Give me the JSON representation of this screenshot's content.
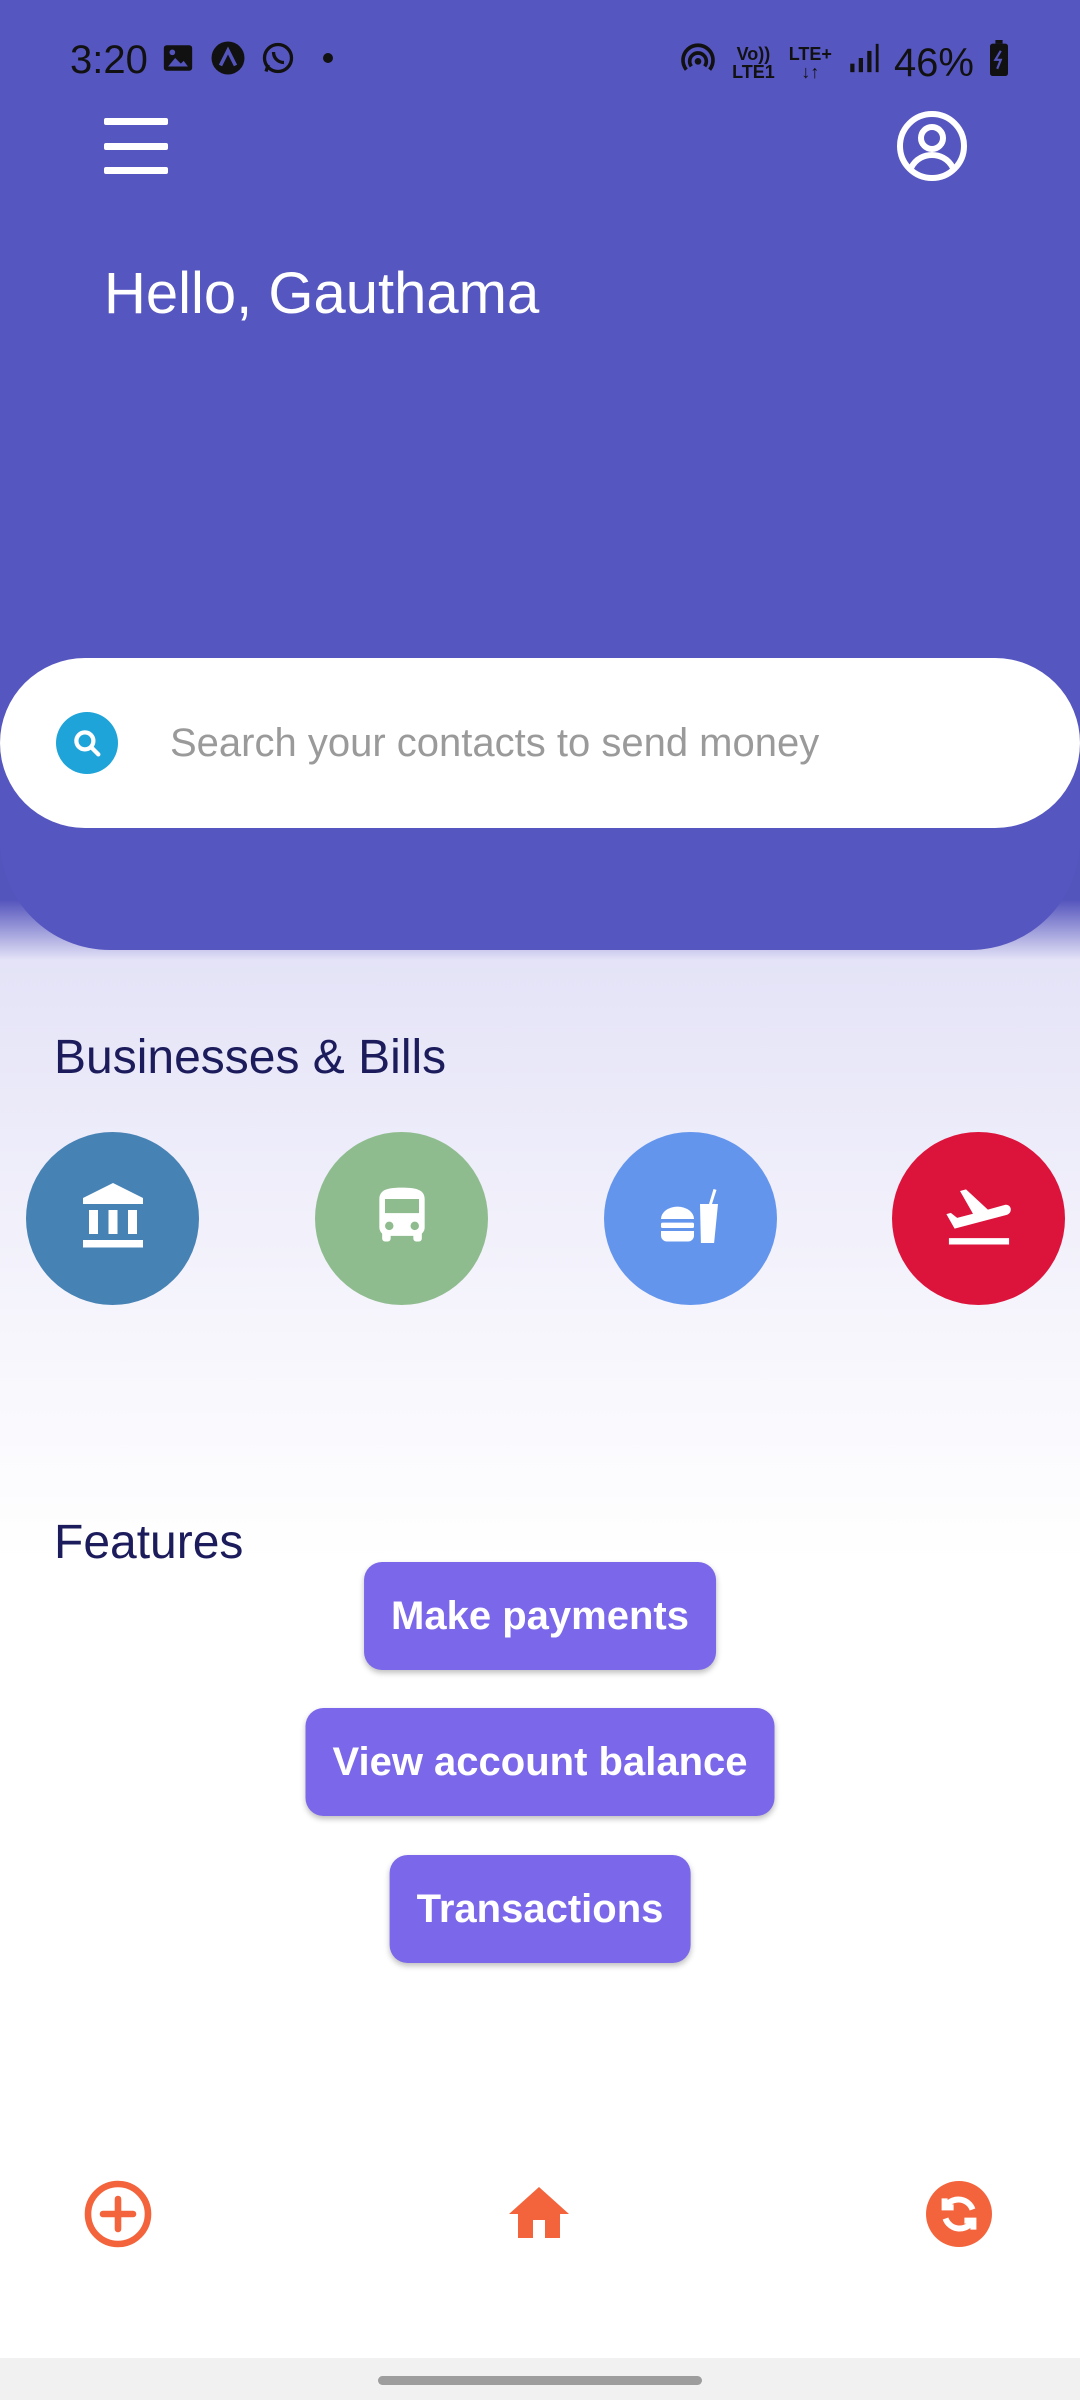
{
  "status_bar": {
    "time": "3:20",
    "left_icons": [
      "image-icon",
      "app-a-icon",
      "whatsapp-icon",
      "dot-icon"
    ],
    "network_labels": {
      "volte_top": "Vo))",
      "volte_bottom": "LTE1",
      "lte_top": "LTE+",
      "lte_bottom": "↓↑"
    },
    "battery": "46%"
  },
  "header": {
    "greeting": "Hello, Gauthama",
    "menu_icon": "hamburger-menu-icon",
    "profile_icon": "account-circle-icon"
  },
  "search": {
    "placeholder": "Search your contacts to send money",
    "icon": "search-icon"
  },
  "businesses": {
    "title": "Businesses & Bills",
    "items": [
      {
        "icon": "bank-icon",
        "color": "#4682b4"
      },
      {
        "icon": "bus-icon",
        "color": "#8fbc8f"
      },
      {
        "icon": "fast-food-icon",
        "color": "#6495ed"
      },
      {
        "icon": "flight-takeoff-icon",
        "color": "#dc143c"
      }
    ]
  },
  "features": {
    "title": "Features",
    "buttons": [
      "Make payments",
      "View account balance",
      "Transactions"
    ],
    "button_color": "#7b67ea"
  },
  "bottom_nav": {
    "items": [
      "add-circle-icon",
      "home-icon",
      "refresh-icon"
    ],
    "color": "#f4643c"
  },
  "colors": {
    "header": "#5656c0",
    "heading_text": "#1c1c5c",
    "search_icon_bg": "#1ea4d8"
  }
}
